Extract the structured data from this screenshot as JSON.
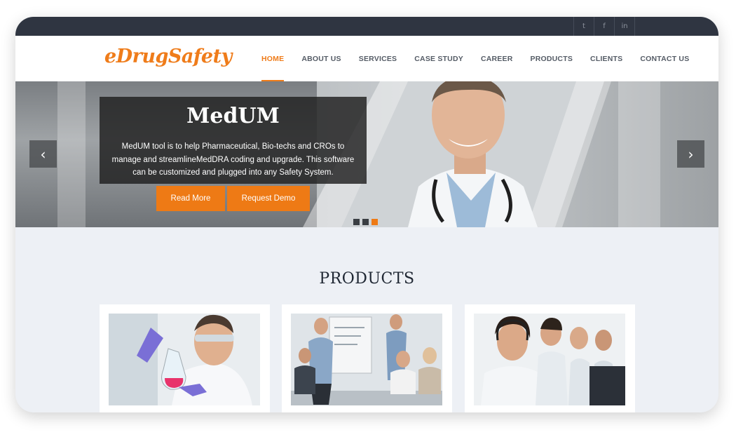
{
  "colors": {
    "accent": "#ee7a15",
    "topbar": "#2f3541",
    "page_bg": "#edf0f5"
  },
  "social": [
    {
      "icon": "twitter-icon",
      "glyph": "t"
    },
    {
      "icon": "facebook-icon",
      "glyph": "f"
    },
    {
      "icon": "linkedin-icon",
      "glyph": "in"
    }
  ],
  "logo": "eDrugSafety",
  "nav": {
    "home": "HOME",
    "about": "ABOUT US",
    "services": "SERVICES",
    "case_study": "CASE STUDY",
    "career": "CAREER",
    "products": "PRODUCTS",
    "clients": "CLIENTS",
    "contact": "CONTACT US"
  },
  "hero": {
    "title": "MedUM",
    "text": "MedUM tool is to help Pharmaceutical, Bio-techs and CROs to manage and streamlineMedDRA coding and upgrade. This software can be customized and plugged into any Safety System.",
    "read_more": "Read More",
    "request_demo": "Request Demo",
    "prev_icon": "chevron-left-icon",
    "next_icon": "chevron-right-icon",
    "slide_count": 3,
    "active_slide": 3
  },
  "products": {
    "title": "PRODUCTS",
    "cards": [
      {
        "image": "scientist-with-flask-image"
      },
      {
        "image": "team-meeting-whiteboard-image"
      },
      {
        "image": "call-center-agents-image"
      }
    ]
  }
}
